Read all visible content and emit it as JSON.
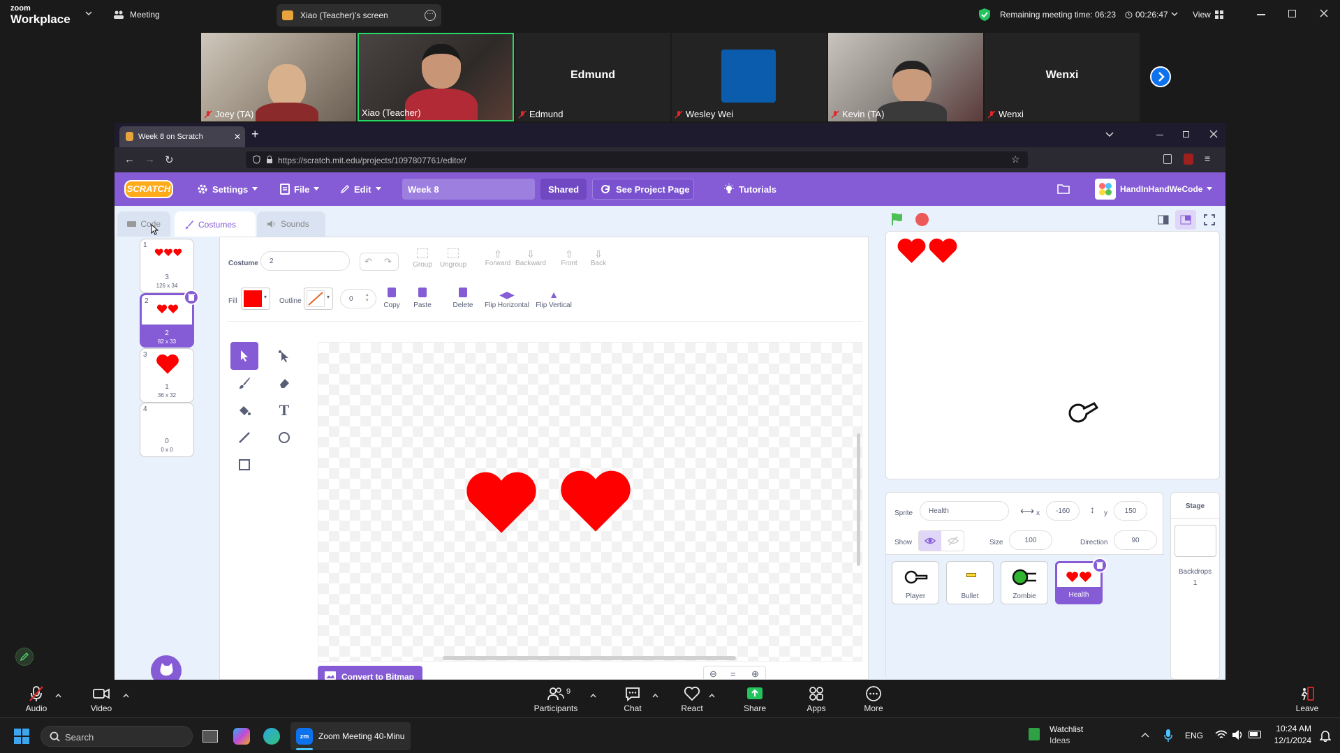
{
  "zoom": {
    "app_line1": "zoom",
    "app_line2": "Workplace",
    "meeting_label": "Meeting",
    "share_label": "Xiao (Teacher)'s screen",
    "remaining_time": "Remaining meeting time: 06:23",
    "elapsed": "00:26:47",
    "view_label": "View",
    "participants": [
      {
        "name": "Joey (TA)",
        "video": true
      },
      {
        "name": "Xiao (Teacher)",
        "video": true,
        "active": true
      },
      {
        "name": "Edmund",
        "video": false
      },
      {
        "name": "Wesley Wei",
        "video": false,
        "square_color": "#0b5cad"
      },
      {
        "name": "Kevin (TA)",
        "video": true
      },
      {
        "name": "Wenxi",
        "video": false
      }
    ],
    "bottom": {
      "audio": "Audio",
      "video": "Video",
      "participants": "Participants",
      "participants_count": "9",
      "chat": "Chat",
      "react": "React",
      "share": "Share",
      "apps": "Apps",
      "more": "More",
      "leave": "Leave"
    }
  },
  "browser": {
    "tab_title": "Week 8 on Scratch",
    "url": "https://scratch.mit.edu/projects/1097807761/editor/"
  },
  "scratch": {
    "logo": "SCRATCH",
    "menu": {
      "settings": "Settings",
      "file": "File",
      "edit": "Edit",
      "project_title": "Week 8",
      "shared": "Shared",
      "see_project": "See Project Page",
      "tutorials": "Tutorials",
      "username": "HandInHandWeCode"
    },
    "tabs": {
      "code": "Code",
      "costumes": "Costumes",
      "sounds": "Sounds"
    },
    "costumes": [
      {
        "num": "1",
        "name": "3",
        "size": "126 x 34"
      },
      {
        "num": "2",
        "name": "2",
        "size": "82 x 33",
        "selected": true
      },
      {
        "num": "3",
        "name": "1",
        "size": "36 x 32"
      },
      {
        "num": "4",
        "name": "0",
        "size": "0 x 0"
      }
    ],
    "editor": {
      "costume_label": "Costume",
      "costume_name": "2",
      "group": "Group",
      "ungroup": "Ungroup",
      "forward": "Forward",
      "backward": "Backward",
      "front": "Front",
      "back": "Back",
      "fill_label": "Fill",
      "fill_color": "#ff0000",
      "outline_label": "Outline",
      "outline_width": "0",
      "copy": "Copy",
      "paste": "Paste",
      "delete": "Delete",
      "flip_h": "Flip Horizontal",
      "flip_v": "Flip Vertical",
      "convert": "Convert to Bitmap"
    },
    "sprite_info": {
      "sprite_label": "Sprite",
      "sprite_name": "Health",
      "x_label": "x",
      "x": "-160",
      "y_label": "y",
      "y": "150",
      "show_label": "Show",
      "size_label": "Size",
      "size": "100",
      "direction_label": "Direction",
      "direction": "90"
    },
    "sprites": [
      "Player",
      "Bullet",
      "Zombie",
      "Health"
    ],
    "stage_panel": {
      "title": "Stage",
      "backdrops_label": "Backdrops",
      "backdrops_count": "1"
    },
    "accent": "#855cd6"
  },
  "taskbar": {
    "search": "Search",
    "zoom_task": "Zoom Meeting 40-Minu",
    "watchlist": "Watchlist",
    "ideas": "Ideas",
    "lang": "ENG",
    "time": "10:24 AM",
    "date": "12/1/2024"
  }
}
